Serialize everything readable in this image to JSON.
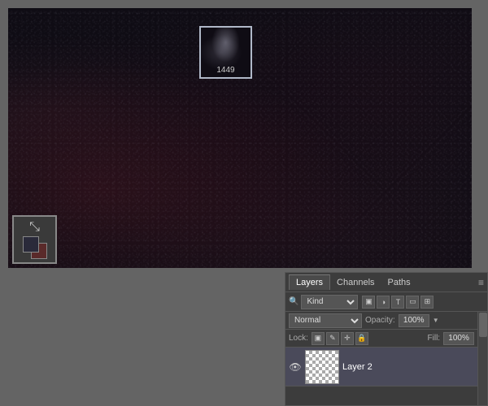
{
  "canvas": {
    "thumbnail_label": "1449"
  },
  "layers_panel": {
    "tabs": [
      {
        "label": "Layers",
        "active": true
      },
      {
        "label": "Channels",
        "active": false
      },
      {
        "label": "Paths",
        "active": false
      }
    ],
    "filter": {
      "search_placeholder": "Kind",
      "kind_option": "Kind"
    },
    "blend_mode": "Normal",
    "opacity_label": "Opacity:",
    "opacity_value": "100%",
    "lock_label": "Lock:",
    "fill_label": "Fill:",
    "fill_value": "100%",
    "layer": {
      "name": "Layer 2",
      "visible": true
    }
  },
  "icons": {
    "menu": "≡",
    "search": "🔍",
    "pixel_filter": "▣",
    "adjust_filter": "◑",
    "type_filter": "T",
    "shape_filter": "▭",
    "smart_filter": "⊞",
    "lock_pixels": "▣",
    "lock_position": "✛",
    "lock_all": "🔒",
    "lock_artboards": "◻",
    "eye": "👁",
    "opacity_down": "▼",
    "fill_down": "▼"
  }
}
